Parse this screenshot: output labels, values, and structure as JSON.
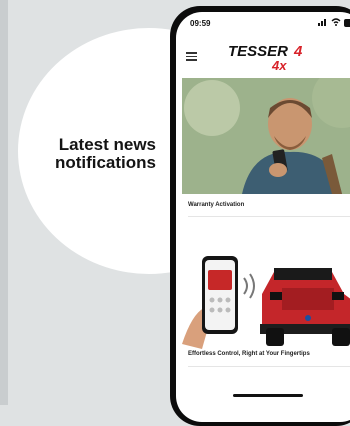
{
  "callout": {
    "line1": "Latest news",
    "line2": "notifications"
  },
  "status_bar": {
    "time": "09:59",
    "signal": "▯",
    "wifi": "≈"
  },
  "app": {
    "logo_main": "TESSER",
    "logo_accent": "4",
    "logo_sub": "4x"
  },
  "cards": [
    {
      "label": "Warranty Activation"
    },
    {
      "label": "Effortless Control, Right at Your Fingertips"
    }
  ],
  "colors": {
    "brand_red": "#d8232a",
    "background": "#dfe2e3"
  }
}
